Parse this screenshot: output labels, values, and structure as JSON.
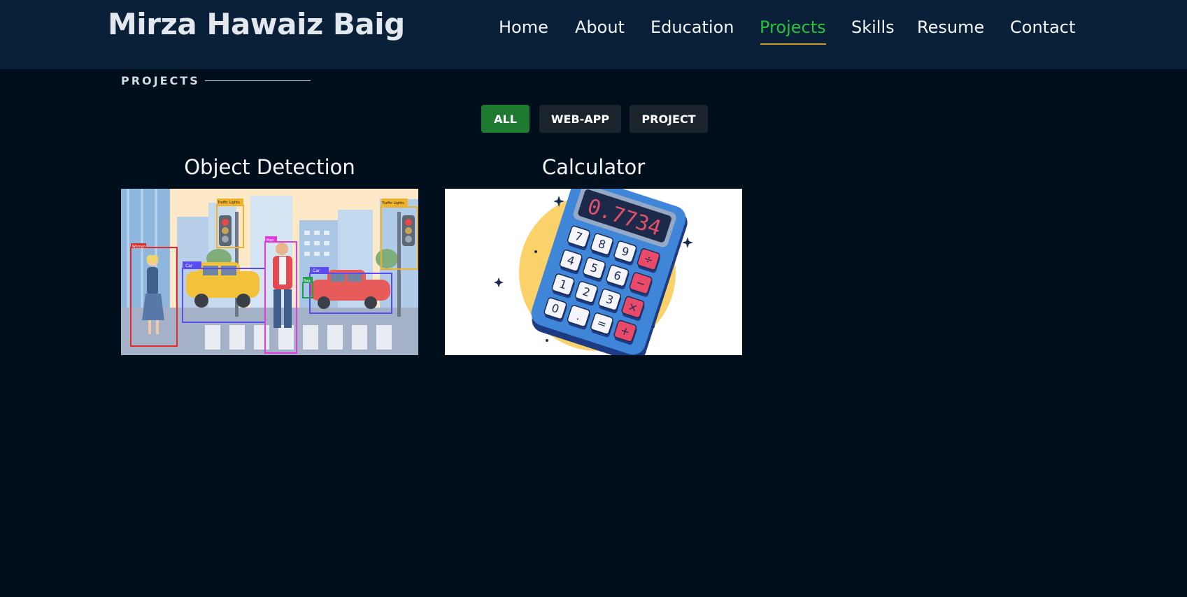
{
  "header": {
    "brand": "Mirza Hawaiz Baig",
    "nav": [
      {
        "label": "Home"
      },
      {
        "label": "About"
      },
      {
        "label": "Education"
      },
      {
        "label": "Projects",
        "active": true
      },
      {
        "label": "Skills"
      },
      {
        "label": "Resume"
      },
      {
        "label": "Contact"
      }
    ]
  },
  "section": {
    "label": "PROJECTS"
  },
  "filters": [
    {
      "label": "ALL",
      "active": true
    },
    {
      "label": "WEB-APP"
    },
    {
      "label": "PROJECT"
    }
  ],
  "projects": [
    {
      "title": "Object Detection",
      "image_labels": {
        "woman": "Woman",
        "car1": "Car",
        "car2": "Car",
        "man": "Man",
        "bag": "Bag",
        "traffic1": "Traffic Lights",
        "traffic2": "Traffic Lights"
      }
    },
    {
      "title": "Calculator",
      "display": "0.7734",
      "keys": [
        "7",
        "8",
        "9",
        "÷",
        "4",
        "5",
        "6",
        "−",
        "1",
        "2",
        "3",
        "×",
        "0",
        ".",
        "=",
        "+"
      ]
    }
  ],
  "colors": {
    "header_bg": "#0a2038",
    "page_bg": "#010f1d",
    "accent_green": "#27c13c",
    "active_button": "#1d7a30",
    "idle_button": "#1b232d",
    "underline": "#c89a2a"
  }
}
